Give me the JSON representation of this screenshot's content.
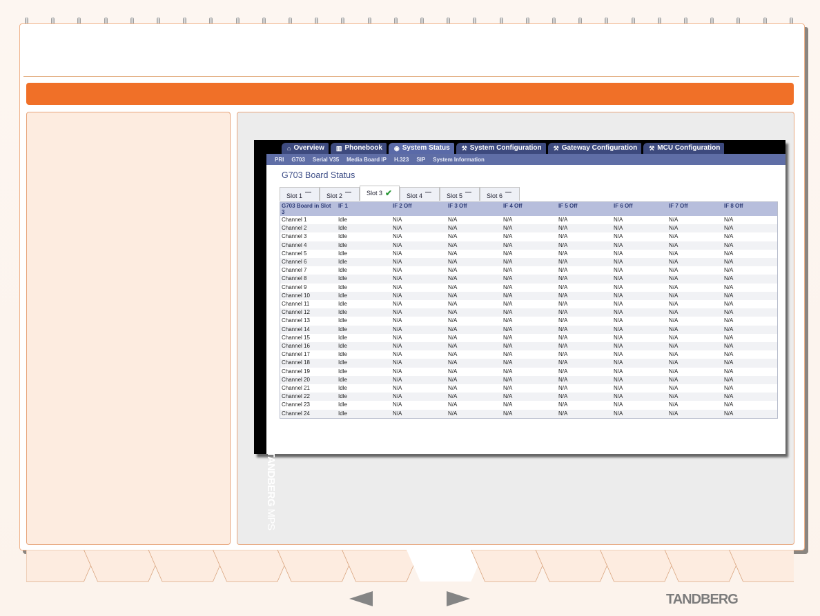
{
  "app": {
    "brand": {
      "bold": "TANDBERG",
      "light": " MPS"
    },
    "main_tabs": [
      {
        "label": "Overview",
        "icon": "home-icon",
        "glyph": "⌂",
        "active": false
      },
      {
        "label": "Phonebook",
        "icon": "phonebook-icon",
        "glyph": "▥",
        "active": false
      },
      {
        "label": "System Status",
        "icon": "status-icon",
        "glyph": "◉",
        "active": true
      },
      {
        "label": "System Configuration",
        "icon": "wrench-icon",
        "glyph": "⚒",
        "active": false
      },
      {
        "label": "Gateway Configuration",
        "icon": "wrench-icon",
        "glyph": "⚒",
        "active": false
      },
      {
        "label": "MCU Configuration",
        "icon": "wrench-icon",
        "glyph": "⚒",
        "active": false
      }
    ],
    "sub_nav": [
      "PRI",
      "G703",
      "Serial V35",
      "Media Board IP",
      "H.323",
      "SIP",
      "System Information"
    ],
    "page_title": "G703 Board Status",
    "slot_tabs": [
      {
        "label": "Slot 1",
        "status": "—",
        "active": false
      },
      {
        "label": "Slot 2",
        "status": "—",
        "active": false
      },
      {
        "label": "Slot 3",
        "status": "✔",
        "active": true
      },
      {
        "label": "Slot 4",
        "status": "—",
        "active": false
      },
      {
        "label": "Slot 5",
        "status": "—",
        "active": false
      },
      {
        "label": "Slot 6",
        "status": "—",
        "active": false
      }
    ],
    "table": {
      "headers": [
        "G703 Board in Slot 3",
        "IF 1",
        "IF 2 Off",
        "IF 3 Off",
        "IF 4 Off",
        "IF 5 Off",
        "IF 6 Off",
        "IF 7 Off",
        "IF 8 Off"
      ],
      "rows": [
        [
          "Channel 1",
          "Idle",
          "N/A",
          "N/A",
          "N/A",
          "N/A",
          "N/A",
          "N/A",
          "N/A"
        ],
        [
          "Channel 2",
          "Idle",
          "N/A",
          "N/A",
          "N/A",
          "N/A",
          "N/A",
          "N/A",
          "N/A"
        ],
        [
          "Channel 3",
          "Idle",
          "N/A",
          "N/A",
          "N/A",
          "N/A",
          "N/A",
          "N/A",
          "N/A"
        ],
        [
          "Channel 4",
          "Idle",
          "N/A",
          "N/A",
          "N/A",
          "N/A",
          "N/A",
          "N/A",
          "N/A"
        ],
        [
          "Channel 5",
          "Idle",
          "N/A",
          "N/A",
          "N/A",
          "N/A",
          "N/A",
          "N/A",
          "N/A"
        ],
        [
          "Channel 6",
          "Idle",
          "N/A",
          "N/A",
          "N/A",
          "N/A",
          "N/A",
          "N/A",
          "N/A"
        ],
        [
          "Channel 7",
          "Idle",
          "N/A",
          "N/A",
          "N/A",
          "N/A",
          "N/A",
          "N/A",
          "N/A"
        ],
        [
          "Channel 8",
          "Idle",
          "N/A",
          "N/A",
          "N/A",
          "N/A",
          "N/A",
          "N/A",
          "N/A"
        ],
        [
          "Channel 9",
          "Idle",
          "N/A",
          "N/A",
          "N/A",
          "N/A",
          "N/A",
          "N/A",
          "N/A"
        ],
        [
          "Channel 10",
          "Idle",
          "N/A",
          "N/A",
          "N/A",
          "N/A",
          "N/A",
          "N/A",
          "N/A"
        ],
        [
          "Channel 11",
          "Idle",
          "N/A",
          "N/A",
          "N/A",
          "N/A",
          "N/A",
          "N/A",
          "N/A"
        ],
        [
          "Channel 12",
          "Idle",
          "N/A",
          "N/A",
          "N/A",
          "N/A",
          "N/A",
          "N/A",
          "N/A"
        ],
        [
          "Channel 13",
          "Idle",
          "N/A",
          "N/A",
          "N/A",
          "N/A",
          "N/A",
          "N/A",
          "N/A"
        ],
        [
          "Channel 14",
          "Idle",
          "N/A",
          "N/A",
          "N/A",
          "N/A",
          "N/A",
          "N/A",
          "N/A"
        ],
        [
          "Channel 15",
          "Idle",
          "N/A",
          "N/A",
          "N/A",
          "N/A",
          "N/A",
          "N/A",
          "N/A"
        ],
        [
          "Channel 16",
          "Idle",
          "N/A",
          "N/A",
          "N/A",
          "N/A",
          "N/A",
          "N/A",
          "N/A"
        ],
        [
          "Channel 17",
          "Idle",
          "N/A",
          "N/A",
          "N/A",
          "N/A",
          "N/A",
          "N/A",
          "N/A"
        ],
        [
          "Channel 18",
          "Idle",
          "N/A",
          "N/A",
          "N/A",
          "N/A",
          "N/A",
          "N/A",
          "N/A"
        ],
        [
          "Channel 19",
          "Idle",
          "N/A",
          "N/A",
          "N/A",
          "N/A",
          "N/A",
          "N/A",
          "N/A"
        ],
        [
          "Channel 20",
          "Idle",
          "N/A",
          "N/A",
          "N/A",
          "N/A",
          "N/A",
          "N/A",
          "N/A"
        ],
        [
          "Channel 21",
          "Idle",
          "N/A",
          "N/A",
          "N/A",
          "N/A",
          "N/A",
          "N/A",
          "N/A"
        ],
        [
          "Channel 22",
          "Idle",
          "N/A",
          "N/A",
          "N/A",
          "N/A",
          "N/A",
          "N/A",
          "N/A"
        ],
        [
          "Channel 23",
          "Idle",
          "N/A",
          "N/A",
          "N/A",
          "N/A",
          "N/A",
          "N/A",
          "N/A"
        ],
        [
          "Channel 24",
          "Idle",
          "N/A",
          "N/A",
          "N/A",
          "N/A",
          "N/A",
          "N/A",
          "N/A"
        ]
      ]
    }
  },
  "footer": {
    "brand": "TANDBERG",
    "prev_icon": "arrow-left-icon",
    "next_icon": "arrow-right-icon"
  },
  "colors": {
    "accent_orange": "#f07028",
    "nav_blue": "#3d4a7e",
    "subnav_blue": "#5f6ea6",
    "header_blue": "#b7bedc"
  }
}
